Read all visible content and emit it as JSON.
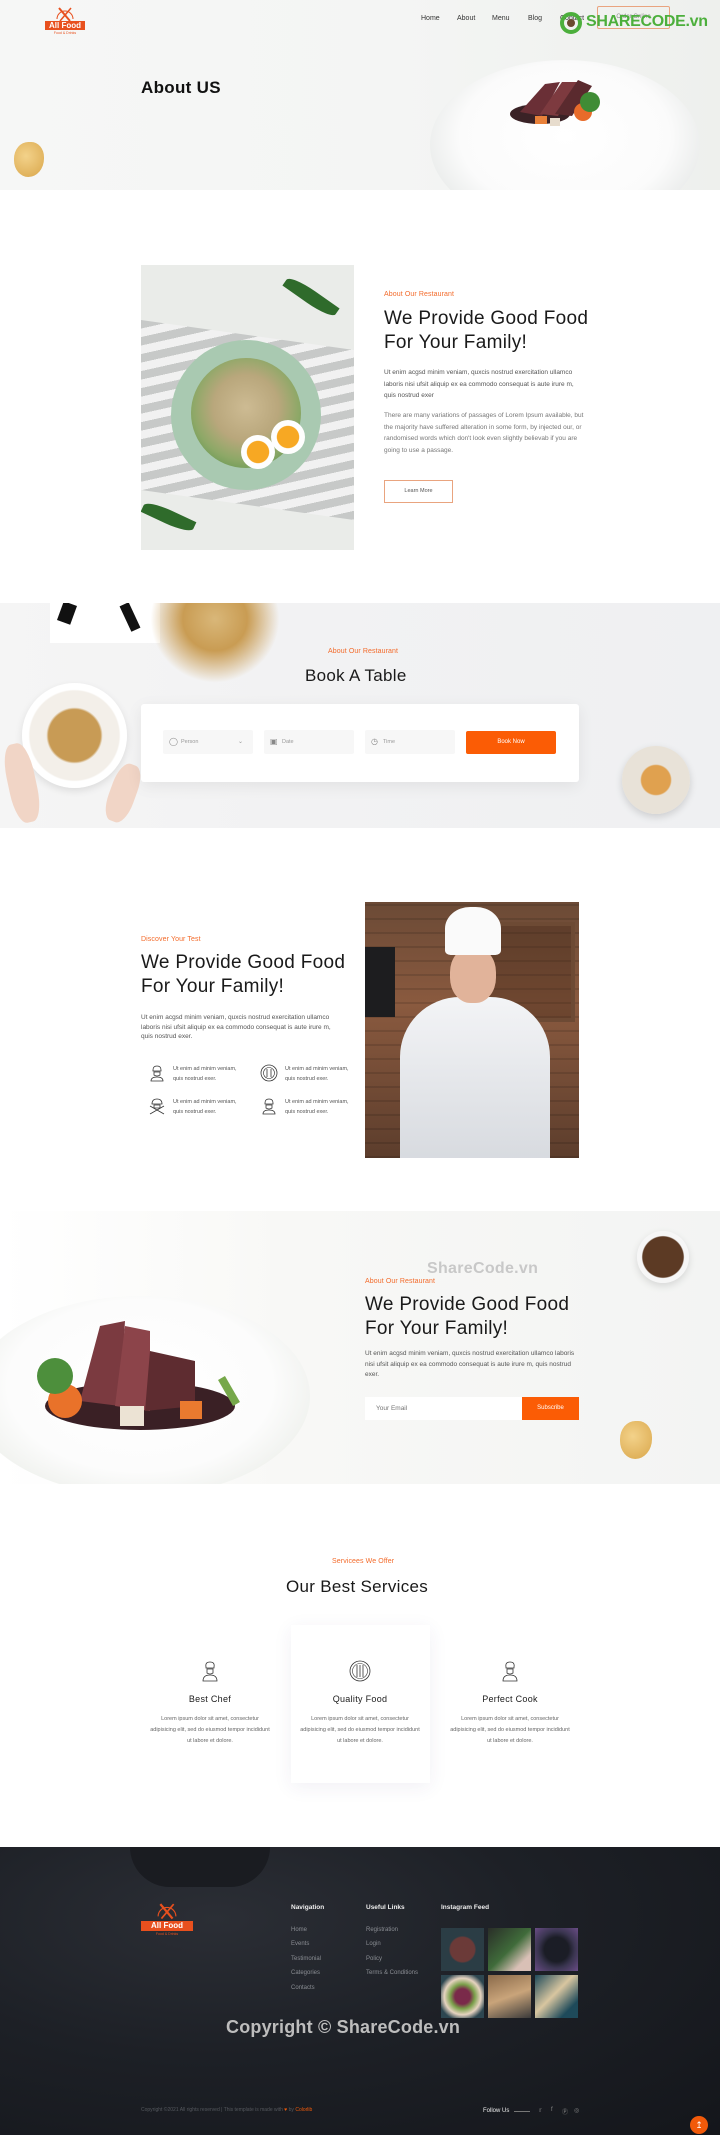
{
  "header": {
    "logo_text": "All Food",
    "logo_sub": "Food & Drinks",
    "nav": [
      "Home",
      "About",
      "Menu",
      "Blog",
      "Contact"
    ],
    "order_button": "Order Online",
    "watermark_logo": "SHARECODE.vn"
  },
  "hero": {
    "title": "About US"
  },
  "about": {
    "kicker": "About Our Restaurant",
    "title_line1": "We Provide Good Food",
    "title_line2": "For Your Family!",
    "para1": "Ut enim acgsd minim veniam, quxcis nostrud exercitation ullamco laboris nisi ufsit aliquip ex ea commodo consequat is aute irure m, quis nostrud exer",
    "para2": "There are many variations of passages of Lorem Ipsum available, but the majority have suffered alteration in some form, by injected our, or randomised words which don't look even slightly believab if you are going to use a passage.",
    "button": "Learn More"
  },
  "booking": {
    "kicker": "About Our Restaurant",
    "title": "Book A Table",
    "person_placeholder": "Person",
    "date_placeholder": "Date",
    "time_placeholder": "Time",
    "button": "Book Now"
  },
  "chef": {
    "kicker": "Discover Your Test",
    "title_line1": "We Provide Good Food",
    "title_line2": "For Your Family!",
    "para": "Ut enim acgsd minim veniam, quxcis nostrud exercitation ullamco laboris nisi ufsit aliquip ex ea commodo consequat is aute irure m, quis nostrud exer.",
    "features": [
      {
        "icon": "chef-icon",
        "line1": "Ut enim ad minim veniam,",
        "line2": "quis nostrud exer."
      },
      {
        "icon": "plate-cutlery-icon",
        "line1": "Ut enim ad minim veniam,",
        "line2": "quis nostrud exer."
      },
      {
        "icon": "chef-crossed-utensils-icon",
        "line1": "Ut enim ad minim veniam,",
        "line2": "quis nostrud exer."
      },
      {
        "icon": "chef-icon",
        "line1": "Ut enim ad minim veniam,",
        "line2": "quis nostrud exer."
      }
    ]
  },
  "subscribe": {
    "watermark": "ShareCode.vn",
    "kicker": "About Our Restaurant",
    "title_line1": "We Provide Good Food",
    "title_line2": "For Your Family!",
    "para": "Ut enim acgsd minim veniam, quxcis nostrud exercitation ullamco laboris nisi ufsit aliquip ex ea commodo consequat is aute irure m, quis nostrud exer.",
    "email_placeholder": "Your Email",
    "button": "Subscribe"
  },
  "services": {
    "kicker": "Servicees We Offer",
    "title": "Our Best Services",
    "items": [
      {
        "icon": "chef-icon",
        "title": "Best Chef",
        "desc": "Lorem ipsum dolor sit amet, consectetur adipisicing elit, sed do eiusmod tempor incididunt ut labore et dolore."
      },
      {
        "icon": "plate-cutlery-icon",
        "title": "Quality Food",
        "desc": "Lorem ipsum dolor sit amet, consectetur adipisicing elit, sed do eiusmod tempor incididunt ut labore et dolore."
      },
      {
        "icon": "chef-icon",
        "title": "Perfect Cook",
        "desc": "Lorem ipsum dolor sit amet, consectetur adipisicing elit, sed do eiusmod tempor incididunt ut labore et dolore."
      }
    ]
  },
  "footer": {
    "logo_text": "All Food",
    "logo_sub": "Food & Drinks",
    "navigation_title": "Navigation",
    "navigation": [
      "Home",
      "Events",
      "Testimonial",
      "Categories",
      "Contacts"
    ],
    "useful_title": "Useful Links",
    "useful": [
      "Registration",
      "Login",
      "Policy",
      "Terms & Conditions"
    ],
    "instagram_title": "Instagram Feed",
    "watermark": "Copyright © ShareCode.vn",
    "copyright_prefix": "Copyright ©2021 All rights reserved | This template is made with",
    "copyright_by": "by",
    "copyright_brand": "Colorlib",
    "follow_us": "Follow Us",
    "social": [
      "twitter",
      "facebook",
      "pinterest",
      "instagram"
    ]
  },
  "colors": {
    "accent": "#fb5c05",
    "kicker": "#f36b2b",
    "footer_bg": "#1d2026"
  }
}
